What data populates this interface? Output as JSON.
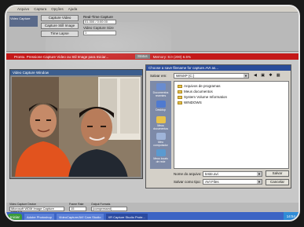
{
  "menubar": [
    "Arquivo",
    "Captura",
    "Opções",
    "Ajuda"
  ],
  "toolpanel": {
    "group_label": "Video Capture",
    "capture_video_label": "Capture Video",
    "capture_still_label": "Capture Still Image",
    "timelapse_label": "Time Lapse",
    "frame_time_label": "Real-Time Capture",
    "frame_time_value": "01:300 / 0:00:00",
    "capture_size_label": "Video Capture Size",
    "capture_size_value": "1"
  },
  "statusbar": {
    "message": "Pronto. Pressione Capture Video ou Stil Image para Iniciar...",
    "state": "Status",
    "meta": "Memory: 8.0 (200) 6.5%"
  },
  "video_window": {
    "title": "Video Capture Window"
  },
  "dialog": {
    "title": "Choose a save filename for capture.AVI as...",
    "save_in_label": "Salvar em:",
    "save_in_value": "WINXP (C:)",
    "places": [
      "Documentos recentes",
      "Desktop",
      "Meus documentos",
      "Meu computador",
      "Meus locais de rede"
    ],
    "files": [
      "Arquivos de programas",
      "Meus documentos",
      "System Volume Information",
      "WINDOWS"
    ],
    "filename_label": "Nome do arquivo:",
    "filename_value": "teste.avi",
    "filetype_label": "Salvar como tipo:",
    "filetype_value": "AVI Files",
    "save_button": "Salvar",
    "cancel_button": "Cancelar"
  },
  "bottompanel": {
    "device_label": "Video Capture Device",
    "device_value": "Microsoft WDM Image Capture (Win32)",
    "frame_rate_label": "Frame Rate",
    "frame_rate_value": "15",
    "format_label": "Output Formats",
    "format_value": "(compressed)"
  },
  "taskbar": {
    "start_label": "Iniciar",
    "tasks": [
      "Adobe Photoshop",
      "VideoCapture/AVI Cam Studio",
      "XR Capture Studio Prote..."
    ],
    "clock": "14:54"
  },
  "colors": {
    "statusbar_bg": "#c41818",
    "titlebar_bg": "#2a4c9a",
    "taskbar_bg": "#3c64c4"
  }
}
